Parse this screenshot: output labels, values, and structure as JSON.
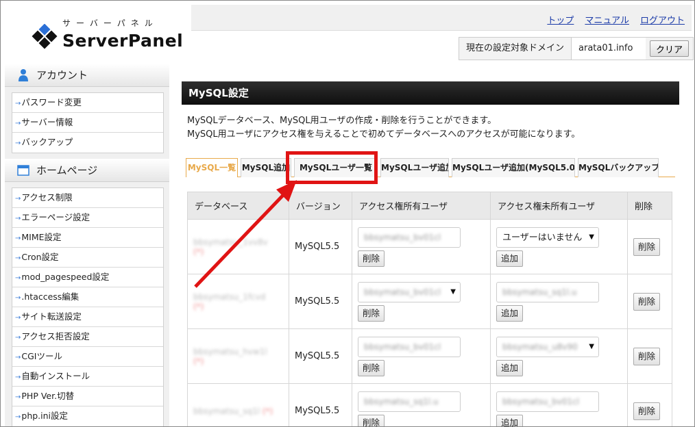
{
  "logo": {
    "kana": "サーバーパネル",
    "name": "ServerPanel"
  },
  "top_links": [
    "トップ",
    "マニュアル",
    "ログアウト"
  ],
  "domain": {
    "label": "現在の設定対象ドメイン",
    "value": "arata01.info",
    "clear": "クリア"
  },
  "sidebar": {
    "account": {
      "heading": "アカウント",
      "items": [
        "パスワード変更",
        "サーバー情報",
        "バックアップ"
      ]
    },
    "homepage": {
      "heading": "ホームページ",
      "items": [
        "アクセス制限",
        "エラーページ設定",
        "MIME設定",
        "Cron設定",
        "mod_pagespeed設定",
        ".htaccess編集",
        "サイト転送設定",
        "アクセス拒否設定",
        "CGIツール",
        "自動インストール",
        "PHP Ver.切替",
        "php.ini設定"
      ]
    }
  },
  "main": {
    "title": "MySQL設定",
    "desc1": "MySQLデータベース、MySQL用ユーザの作成・削除を行うことができます。",
    "desc2": "MySQL用ユーザにアクセス権を与えることで初めてデータベースへのアクセスが可能になります。",
    "tabs": [
      "MySQL一覧",
      "MySQL追加",
      "MySQLユーザ一覧",
      "MySQLユーザ追加",
      "MySQLユーザ追加(MySQL5.0)",
      "MySQLバックアップ"
    ],
    "columns": [
      "データベース",
      "バージョン",
      "アクセス権所有ユーザ",
      "アクセス権未所有ユーザ",
      "削除"
    ],
    "rows": [
      {
        "db": "bbsymatsu_1vv8v",
        "mark": "(*)",
        "version": "MySQL5.5",
        "owned": "bbsymatsu_bv01cl",
        "unowned": "ユーザーはいません"
      },
      {
        "db": "bbsymatsu_1fcvd",
        "mark": "(*)",
        "version": "MySQL5.5",
        "owned": "bbsymatsu_bv01cl",
        "unowned": "bbsymatsu_sq1l.u"
      },
      {
        "db": "bbsymatsu_hvw1l",
        "mark": "(*)",
        "version": "MySQL5.5",
        "owned": "bbsymatsu_bv01cl",
        "unowned": "bbsymatsu_u8v90"
      },
      {
        "db": "bbsymatsu_sq1l",
        "mark": "(*)",
        "version": "MySQL5.5",
        "owned": "bbsymatsu_sq1l.u",
        "unowned": "bbsymatsu_bv01cl"
      }
    ],
    "btn_delete": "削除",
    "btn_add": "追加"
  },
  "colors": {
    "accent": "#e8a94a",
    "highlight": "#e01414",
    "link": "#1a3aa8"
  }
}
